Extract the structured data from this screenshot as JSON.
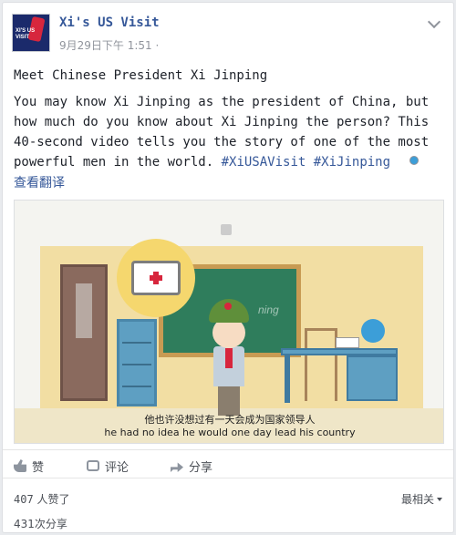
{
  "post": {
    "page_name": "Xi's US Visit",
    "avatar_text": "XI'S US VISIT",
    "timestamp": "9月29日下午 1:51",
    "separator": "·",
    "title": "Meet Chinese President Xi Jinping",
    "body_text": "You may know Xi Jinping as the president of China, but how much do you know about Xi Jinping the person? This 40-second video tells you the story of one of the most powerful men in the world.",
    "hashtags": [
      "#XiUSAVisit",
      "#XiJinping"
    ],
    "translate_label": "查看翻译"
  },
  "video": {
    "board_text": "ning",
    "subtitle_zh": "他也许没想过有一天会成为国家领导人",
    "subtitle_en": "he had no idea he would one day lead his country"
  },
  "actions": {
    "like_label": "赞",
    "comment_label": "评论",
    "share_label": "分享"
  },
  "stats": {
    "likes_count": "407",
    "likes_suffix": " 人赞了",
    "sort_label": "最相关",
    "shares_text": "431次分享"
  },
  "colors": {
    "link": "#365899",
    "avatar_bg": "#1b2a6b",
    "brand_red": "#d7263d"
  }
}
